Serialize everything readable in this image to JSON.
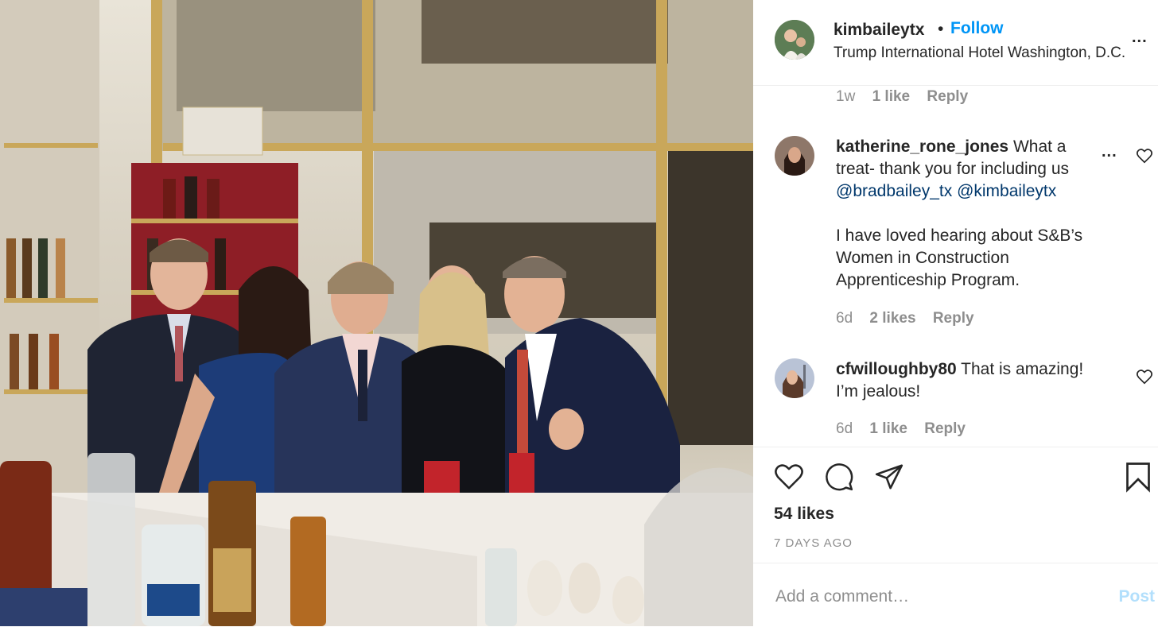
{
  "post": {
    "author": "kimbaileytx",
    "follow_label": "Follow",
    "separator": "•",
    "location": "Trump International Hotel Washington, D.C.",
    "more_label": "...",
    "photo_alt": "Five people posing at a bar"
  },
  "first_comment_meta": {
    "time": "1w",
    "likes": "1 like",
    "reply": "Reply"
  },
  "comments": [
    {
      "user": "katherine_rone_jones",
      "text_line1": "What a",
      "text_line2": "treat- thank you for including us",
      "mention1": "@bradbailey_tx",
      "mention2": "@kimbaileytx",
      "para2_line1": "I have loved hearing about S&B’s",
      "para2_line2": "Women in Construction",
      "para2_line3": "Apprenticeship Program.",
      "more_label": "...",
      "time": "6d",
      "likes": "2 likes",
      "reply": "Reply"
    },
    {
      "user": "cfwilloughby80",
      "text_line1": "That is amazing!",
      "text_line2": "I’m jealous!",
      "time": "6d",
      "likes": "1 like",
      "reply": "Reply"
    }
  ],
  "engagement": {
    "likes": "54 likes",
    "posted": "7 DAYS AGO"
  },
  "composer": {
    "placeholder": "Add a comment…",
    "post_label": "Post"
  },
  "icons": [
    "heart-icon",
    "comment-icon",
    "share-icon",
    "bookmark-icon",
    "more-icon"
  ],
  "colors": {
    "accent": "#0095f6",
    "text": "#262626",
    "muted": "#8e8e8e",
    "post_disabled": "#b2dffc"
  }
}
